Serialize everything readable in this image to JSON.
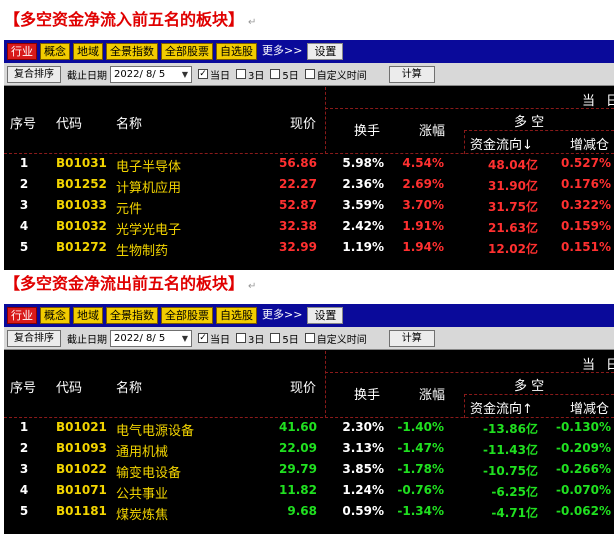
{
  "sections": [
    {
      "heading": "【多空资金净流入前五名的板块】",
      "return_mark": "↵",
      "direction": "up",
      "flow_arrow": "↓",
      "rows": [
        {
          "no": "1",
          "code": "B01031",
          "name": "电子半导体",
          "price": "56.86",
          "turnover": "5.98%",
          "change": "4.54%",
          "flow": "48.04亿",
          "pct": "0.527%"
        },
        {
          "no": "2",
          "code": "B01252",
          "name": "计算机应用",
          "price": "22.27",
          "turnover": "2.36%",
          "change": "2.69%",
          "flow": "31.90亿",
          "pct": "0.176%"
        },
        {
          "no": "3",
          "code": "B01033",
          "name": "元件",
          "price": "52.87",
          "turnover": "3.59%",
          "change": "3.70%",
          "flow": "31.75亿",
          "pct": "0.322%"
        },
        {
          "no": "4",
          "code": "B01032",
          "name": "光学光电子",
          "price": "32.38",
          "turnover": "2.42%",
          "change": "1.91%",
          "flow": "21.63亿",
          "pct": "0.159%"
        },
        {
          "no": "5",
          "code": "B01272",
          "name": "生物制药",
          "price": "32.99",
          "turnover": "1.19%",
          "change": "1.94%",
          "flow": "12.02亿",
          "pct": "0.151%"
        }
      ]
    },
    {
      "heading": "【多空资金净流出前五名的板块】",
      "return_mark": "↵",
      "direction": "down",
      "flow_arrow": "↑",
      "rows": [
        {
          "no": "1",
          "code": "B01021",
          "name": "电气电源设备",
          "price": "41.60",
          "turnover": "2.30%",
          "change": "-1.40%",
          "flow": "-13.86亿",
          "pct": "-0.130%"
        },
        {
          "no": "2",
          "code": "B01093",
          "name": "通用机械",
          "price": "22.09",
          "turnover": "3.13%",
          "change": "-1.47%",
          "flow": "-11.43亿",
          "pct": "-0.209%"
        },
        {
          "no": "3",
          "code": "B01022",
          "name": "输变电设备",
          "price": "29.79",
          "turnover": "3.85%",
          "change": "-1.78%",
          "flow": "-10.75亿",
          "pct": "-0.266%"
        },
        {
          "no": "4",
          "code": "B01071",
          "name": "公共事业",
          "price": "11.82",
          "turnover": "1.24%",
          "change": "-0.76%",
          "flow": "-6.25亿",
          "pct": "-0.070%"
        },
        {
          "no": "5",
          "code": "B01181",
          "name": "煤炭炼焦",
          "price": "9.68",
          "turnover": "0.59%",
          "change": "-1.34%",
          "flow": "-4.71亿",
          "pct": "-0.062%"
        }
      ]
    }
  ],
  "tabs": [
    "行业",
    "概念",
    "地域",
    "全景指数",
    "全部股票",
    "自选股"
  ],
  "more_label": "更多>>",
  "settings_label": "设置",
  "toolbar": {
    "sort_button": "复合排序",
    "date_label": "截止日期",
    "date_value": "2022/ 8/ 5",
    "options": [
      {
        "label": "当日",
        "checked": true
      },
      {
        "label": "3日",
        "checked": false
      },
      {
        "label": "5日",
        "checked": false
      },
      {
        "label": "自定义时间",
        "checked": false
      }
    ],
    "calc_button": "计算"
  },
  "header": {
    "period_left": "当",
    "period_right": "日",
    "no": "序号",
    "code": "代码",
    "name": "名称",
    "price": "现价",
    "turnover": "换手",
    "change": "涨幅",
    "group": "多 空",
    "flow": "资金流向",
    "pct": "增减仓"
  },
  "colors": {
    "up": "#ff3030",
    "down": "#20e020",
    "heading": "#e00000",
    "tab_active": "#d81a1a",
    "tab": "#f2cc00",
    "tabbar": "#0a0a9a"
  }
}
